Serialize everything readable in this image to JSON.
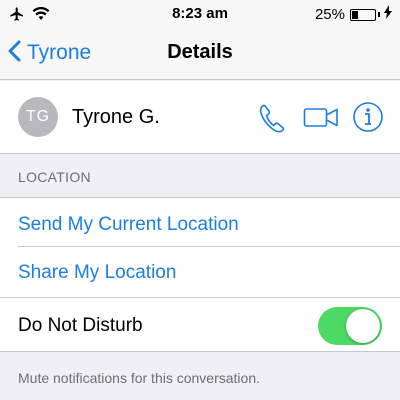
{
  "status_bar": {
    "time": "8:23 am",
    "battery_percent": "25%",
    "battery_level": 0.25,
    "icons": [
      "airplane-icon",
      "wifi-icon",
      "battery-icon",
      "charging-icon"
    ]
  },
  "nav": {
    "back_label": "Tyrone",
    "title": "Details"
  },
  "contact": {
    "initials": "TG",
    "name": "Tyrone G.",
    "actions": [
      "phone-icon",
      "video-icon",
      "info-icon"
    ]
  },
  "location": {
    "header": "LOCATION",
    "send_current": "Send My Current Location",
    "share": "Share My Location"
  },
  "do_not_disturb": {
    "label": "Do Not Disturb",
    "enabled": true,
    "note": "Mute notifications for this conversation."
  },
  "colors": {
    "accent": "#1a7fe0",
    "toggle_on": "#4cd964",
    "background": "#efeff4"
  }
}
